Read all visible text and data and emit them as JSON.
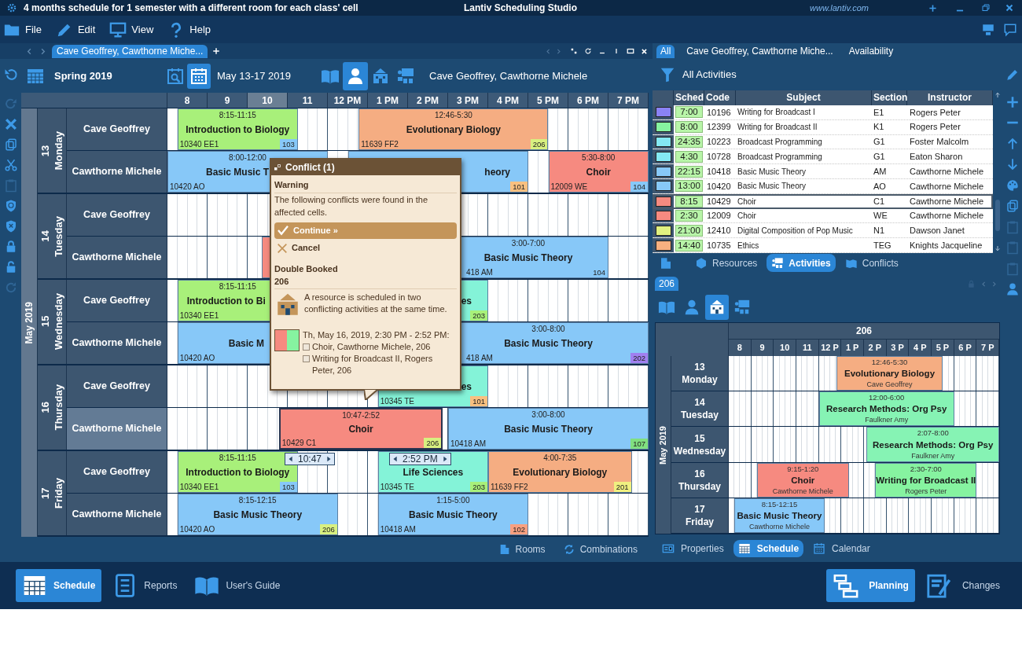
{
  "title_bar": {
    "title": "4 months schedule for 1 semester with a different room for each class' cell",
    "app_name": "Lantiv Scheduling Studio",
    "website": "www.lantiv.com"
  },
  "menu": [
    "File",
    "Edit",
    "View",
    "Help"
  ],
  "document_tabs": [
    {
      "label": "Cave Geoffrey, Cawthorne Miche...",
      "selected": true
    }
  ],
  "side_tools": [
    {
      "disabled": true
    },
    {
      "disabled": false
    },
    {
      "disabled": false
    },
    {
      "disabled": false
    },
    {
      "disabled": true
    },
    {
      "disabled": false
    },
    {
      "disabled": false
    },
    {
      "disabled": false
    },
    {
      "disabled": false
    },
    {
      "disabled": true
    }
  ],
  "toolbar": {
    "term": "Spring 2019",
    "date_buttons": [
      {
        "selected": false
      },
      {
        "selected": true
      }
    ],
    "date_range": "May 13-17 2019",
    "view_modes": [
      {
        "selected": false
      },
      {
        "selected": true
      },
      {
        "selected": false
      },
      {
        "selected": false
      }
    ],
    "resources": "Cave Geoffrey, Cawthorne Michele"
  },
  "schedule": {
    "month": "May 2019",
    "hours": [
      {
        "label": "8",
        "selected": false
      },
      {
        "label": "9",
        "selected": false
      },
      {
        "label": "10",
        "selected": true
      },
      {
        "label": "11",
        "selected": false
      },
      {
        "label": "12 PM",
        "selected": false
      },
      {
        "label": "1 PM",
        "selected": false
      },
      {
        "label": "2 PM",
        "selected": false
      },
      {
        "label": "3 PM",
        "selected": false
      },
      {
        "label": "4 PM",
        "selected": false
      },
      {
        "label": "5 PM",
        "selected": false
      },
      {
        "label": "6 PM",
        "selected": false
      },
      {
        "label": "7 PM",
        "selected": false
      }
    ],
    "days": [
      {
        "date": "13",
        "weekday": "Monday",
        "rows": [
          {
            "name": "Cave Geoffrey",
            "selected": false,
            "events": [
              {
                "time": "8:15-11:15",
                "title": "Introduction to Biology",
                "code": "10340 EE1",
                "room": {
                  "label": "103",
                  "color": "#87c8f8"
                },
                "color": "#a8f07a",
                "selected": false
              },
              {
                "time": "12:46-5:30",
                "title": "Evolutionary Biology",
                "code": "11639 FF2",
                "room": {
                  "label": "206",
                  "color": "#d8f080"
                },
                "color": "#f5ad82",
                "selected": false
              }
            ]
          },
          {
            "name": "Cawthorne Michele",
            "selected": false,
            "events": [
              {
                "time": "8:00-12:00",
                "title": "Basic Music T",
                "code": "10420 AO",
                "color": "#87c8f8",
                "selected": false
              },
              {
                "title": "heory",
                "room": {
                  "label": "101",
                  "color": "#f8c080"
                },
                "color": "#87c8f8",
                "selected": false
              },
              {
                "time": "5:30-8:00",
                "title": "Choir",
                "code": "12009 WE",
                "room": {
                  "label": "104",
                  "color": "#87c8f8"
                },
                "color": "#f68a80",
                "selected": false
              }
            ]
          }
        ]
      },
      {
        "date": "14",
        "weekday": "Tuesday",
        "rows": [
          {
            "name": "Cave Geoffrey",
            "selected": false,
            "events": []
          },
          {
            "name": "Cawthorne Michele",
            "selected": false,
            "events": [
              {
                "color": "#f68a80",
                "selected": false
              },
              {
                "time": "3:00-7:00",
                "title": "Basic Music Theory",
                "code": "418 AM",
                "room": {
                  "label": "104",
                  "color": "#87c8f8"
                },
                "color": "#87c8f8",
                "selected": false
              }
            ]
          }
        ]
      },
      {
        "date": "15",
        "weekday": "Wednesday",
        "rows": [
          {
            "name": "Cave Geoffrey",
            "selected": false,
            "events": [
              {
                "time": "8:15-11:15",
                "title": "Introduction to Bi",
                "code": "10340 EE1",
                "color": "#a8f07a",
                "selected": false
              },
              {
                "title": "es",
                "room": {
                  "label": "203",
                  "color": "#a8f07a"
                },
                "color": "#84f3d8",
                "selected": false
              }
            ]
          },
          {
            "name": "Cawthorne Michele",
            "selected": false,
            "events": [
              {
                "title": "Basic M",
                "code": "10420 AO",
                "color": "#87c8f8",
                "selected": false
              },
              {
                "time": "3:00-8:00",
                "title": "Basic Music Theory",
                "code": "418 AM",
                "room": {
                  "label": "202",
                  "color": "#a080f0"
                },
                "color": "#87c8f8",
                "selected": false
              }
            ]
          }
        ]
      },
      {
        "date": "16",
        "weekday": "Thursday",
        "rows": [
          {
            "name": "Cave Geoffrey",
            "selected": false,
            "events": [
              {
                "title": "es",
                "code": "10345 TE",
                "room": {
                  "label": "101",
                  "color": "#f8c080"
                },
                "color": "#84f3d8",
                "selected": false
              }
            ]
          },
          {
            "name": "Cawthorne Michele",
            "selected": true,
            "events": [
              {
                "time": "10:47-2:52",
                "title": "Choir",
                "code": "10429 C1",
                "room": {
                  "label": "206",
                  "color": "#d8f080"
                },
                "color": "#f68a80",
                "selected": true
              },
              {
                "time": "3:00-8:00",
                "title": "Basic Music Theory",
                "code": "10418 AM",
                "room": {
                  "label": "107",
                  "color": "#80e080"
                },
                "color": "#87c8f8",
                "selected": false
              }
            ]
          }
        ]
      },
      {
        "date": "17",
        "weekday": "Friday",
        "rows": [
          {
            "name": "Cave Geoffrey",
            "selected": false,
            "events": [
              {
                "time": "8:15-11:15",
                "title": "Introduction to Biology",
                "code": "10340 EE1",
                "room": {
                  "label": "103",
                  "color": "#87c8f8"
                },
                "color": "#a8f07a",
                "selected": false
              },
              {
                "title": "Life Sciences",
                "code": "10345 TE",
                "room": {
                  "label": "203",
                  "color": "#a8f07a"
                },
                "color": "#84f3d8",
                "selected": false
              },
              {
                "time": "4:00-7:35",
                "title": "Evolutionary Biology",
                "code": "11639 FF2",
                "room": {
                  "label": "201",
                  "color": "#f0f080"
                },
                "color": "#f5ad82",
                "selected": false
              }
            ]
          },
          {
            "name": "Cawthorne Michele",
            "selected": false,
            "events": [
              {
                "time": "8:15-12:15",
                "title": "Basic Music Theory",
                "code": "10420 AO",
                "room": {
                  "label": "206",
                  "color": "#d8f080"
                },
                "color": "#87c8f8",
                "selected": false
              },
              {
                "time": "1:15-5:00",
                "title": "Basic Music Theory",
                "code": "10418 AM",
                "room": {
                  "label": "102",
                  "color": "#f8a080"
                },
                "color": "#87c8f8",
                "selected": false
              }
            ]
          }
        ]
      }
    ]
  },
  "drag_handles": [
    "10:47",
    "2:52 PM"
  ],
  "conflict_popup": {
    "title": "Conflict (1)",
    "heading": "Warning",
    "message": "The following conflicts were found in the affected cells.",
    "continue": "Continue »",
    "cancel": "Cancel",
    "conflict_type": "Double Booked",
    "resource": "206",
    "description": "A resource is scheduled in two conflicting activities at the same time.",
    "when": "Th, May 16, 2019, 2:30 PM - 2:52 PM:",
    "swatch": [
      {
        "color": "#f68a80"
      },
      {
        "color": "#86f3a0"
      }
    ],
    "items": [
      {
        "text": "Choir, Cawthorne Michele, 206",
        "checked": false
      },
      {
        "text": "Writing for Broadcast II, Rogers Peter, 206",
        "checked": false
      }
    ]
  },
  "left_tabs": [
    "Rooms",
    "Combinations"
  ],
  "filter_tabs": [
    {
      "label": "All",
      "selected": true
    },
    {
      "label": "Cave Geoffrey, Cawthorne Miche...",
      "selected": false
    },
    {
      "label": "Availability",
      "selected": false
    }
  ],
  "filter": "All Activities",
  "activities": {
    "columns": [
      "Sched",
      "Code",
      "Subject",
      "Section",
      "Instructor"
    ],
    "rows": [
      {
        "color": "#8a82f5",
        "sched": "7:00",
        "code": "10196",
        "subject": "Writing for Broadcast I",
        "section": "E1",
        "instructor": "Rogers Peter",
        "selected": false
      },
      {
        "color": "#86f3a0",
        "sched": "8:00",
        "code": "12399",
        "subject": "Writing for Broadcast II",
        "section": "K1",
        "instructor": "Rogers Peter",
        "selected": false
      },
      {
        "color": "#84e8f3",
        "sched": "24:35",
        "code": "10223",
        "subject": "Broadcast Programming",
        "section": "G1",
        "instructor": "Foster Malcolm",
        "selected": false
      },
      {
        "color": "#84e8f3",
        "sched": "4:30",
        "code": "10728",
        "subject": "Broadcast Programming",
        "section": "G1",
        "instructor": "Eaton Sharon",
        "selected": false
      },
      {
        "color": "#87c8f8",
        "sched": "22:15",
        "code": "10418",
        "subject": "Basic Music Theory",
        "section": "AM",
        "instructor": "Cawthorne Michele",
        "selected": false
      },
      {
        "color": "#87c8f8",
        "sched": "13:00",
        "code": "10420",
        "subject": "Basic Music Theory",
        "section": "AO",
        "instructor": "Cawthorne Michele",
        "selected": false
      },
      {
        "color": "#f68a80",
        "sched": "8:15",
        "code": "10429",
        "subject": "Choir",
        "section": "C1",
        "instructor": "Cawthorne Michele",
        "selected": true
      },
      {
        "color": "#f68a80",
        "sched": "2:30",
        "code": "12009",
        "subject": "Choir",
        "section": "WE",
        "instructor": "Cawthorne Michele",
        "selected": false
      },
      {
        "color": "#e0f080",
        "sched": "21:00",
        "code": "12410",
        "subject": "Digital Composition of Pop Music",
        "section": "N1",
        "instructor": "Dawson Janet",
        "selected": false
      },
      {
        "color": "#f8b080",
        "sched": "14:40",
        "code": "10735",
        "subject": "Ethics",
        "section": "TEG",
        "instructor": "Knights Jacqueline",
        "selected": false
      }
    ]
  },
  "side_tabs": [
    {
      "label": "Resources",
      "selected": false
    },
    {
      "label": "Activities",
      "selected": true
    },
    {
      "label": "Conflicts",
      "selected": false
    }
  ],
  "resource_tab": "206",
  "resource_types": [
    {
      "selected": false
    },
    {
      "selected": false
    },
    {
      "selected": true
    },
    {
      "selected": false
    }
  ],
  "right_tools": [
    {
      "disabled": false
    },
    {
      "disabled": false
    },
    {
      "disabled": false
    },
    {
      "disabled": false
    },
    {
      "disabled": false
    },
    {
      "disabled": false
    },
    {
      "disabled": false
    },
    {
      "disabled": true
    },
    {
      "disabled": true
    },
    {
      "disabled": true
    },
    {
      "disabled": false
    }
  ],
  "room_schedule": {
    "title": "206",
    "month": "May 2019",
    "hours": [
      "8",
      "9",
      "10",
      "11",
      "12 P",
      "1 P",
      "2 P",
      "3 P",
      "4 P",
      "5 P",
      "6 P",
      "7 P"
    ],
    "days": [
      {
        "date": "13",
        "weekday": "Monday",
        "events": [
          {
            "time": "12:46-5:30",
            "title": "Evolutionary Biology",
            "person": "Cave Geoffrey",
            "color": "#f5ad82"
          }
        ]
      },
      {
        "date": "14",
        "weekday": "Tuesday",
        "events": [
          {
            "time": "12:00-6:00",
            "title": "Research Methods: Org Psy",
            "person": "Faulkner Amy",
            "color": "#86f3b4"
          }
        ]
      },
      {
        "date": "15",
        "weekday": "Wednesday",
        "events": [
          {
            "time": "2:07-8:00",
            "title": "Research Methods: Org Psy",
            "person": "Faulkner Amy",
            "color": "#86f3b4"
          }
        ]
      },
      {
        "date": "16",
        "weekday": "Thursday",
        "events": [
          {
            "time": "9:15-1:20",
            "title": "Choir",
            "person": "Cawthorne Michele",
            "color": "#f68a80"
          },
          {
            "time": "2:30-7:00",
            "title": "Writing for Broadcast II",
            "person": "Rogers Peter",
            "color": "#86f3a0"
          }
        ]
      },
      {
        "date": "17",
        "weekday": "Friday",
        "events": [
          {
            "time": "8:15-12:15",
            "title": "Basic Music Theory",
            "person": "Cawthorne Michele",
            "color": "#87c8f8"
          }
        ]
      }
    ]
  },
  "right_tabs": [
    {
      "label": "Properties",
      "selected": false
    },
    {
      "label": "Schedule",
      "selected": true
    },
    {
      "label": "Calendar",
      "selected": false
    }
  ],
  "bottom_nav_left": [
    {
      "label": "Schedule",
      "selected": true
    },
    {
      "label": "Reports",
      "selected": false
    },
    {
      "label": "User's Guide",
      "selected": false
    }
  ],
  "bottom_nav_right": [
    {
      "label": "Planning",
      "selected": true
    },
    {
      "label": "Changes",
      "selected": false
    }
  ]
}
